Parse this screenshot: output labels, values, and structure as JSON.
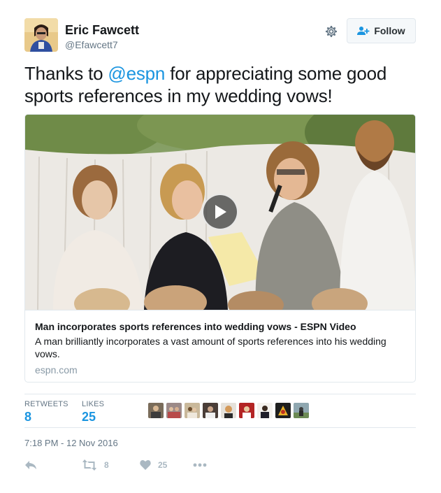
{
  "author": {
    "name": "Eric Fawcett",
    "handle": "@Efawcett7",
    "follow_label": "Follow"
  },
  "tweet": {
    "text_before": "Thanks to ",
    "mention": "@espn",
    "text_after": " for appreciating some good sports references in my wedding vows!"
  },
  "card": {
    "title": "Man incorporates sports references into wedding vows - ESPN Video",
    "description": "A man brilliantly incorporates a vast amount of sports references into his wedding vows.",
    "domain": "espn.com"
  },
  "stats": {
    "retweets_label": "RETWEETS",
    "retweets_value": "8",
    "likes_label": "LIKES",
    "likes_value": "25"
  },
  "timestamp": "7:18 PM - 12 Nov 2016",
  "actions": {
    "retweet_count": "8",
    "like_count": "25"
  },
  "icons": {
    "settings": "gear-icon",
    "follow": "add-user-icon",
    "play": "play-icon",
    "reply": "reply-icon",
    "retweet": "retweet-icon",
    "like": "heart-icon",
    "more": "more-icon"
  },
  "colors": {
    "link": "#1b95e0",
    "muted": "#657786",
    "action": "#aab8c2"
  }
}
